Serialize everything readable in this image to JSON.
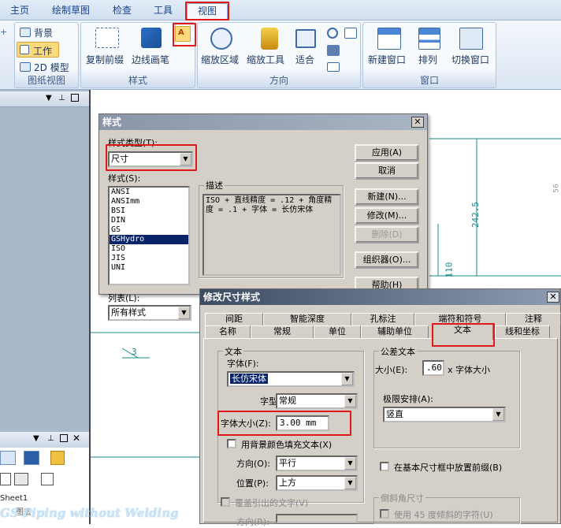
{
  "tabs": [
    "主页",
    "绘制草图",
    "检查",
    "工具",
    "视图"
  ],
  "ribbon": {
    "sheet_view_group": {
      "label": "图纸视图",
      "items": [
        "背景",
        "工作",
        "2D 模型"
      ]
    },
    "style_group": {
      "label": "样式",
      "items": [
        "复制前缀",
        "边线画笔"
      ]
    },
    "orient_group": {
      "label": "方向",
      "items": [
        "缩放区域",
        "缩放工具",
        "适合"
      ]
    },
    "window_group": {
      "label": "窗口",
      "items": [
        "新建窗口",
        "排列",
        "切换窗口"
      ]
    }
  },
  "left_panel": {
    "sheet": "Sheet1",
    "bottom_label": "图层"
  },
  "canvas": {
    "dim_1": "242.5",
    "dim_2": "110",
    "leader": "3",
    "side_dim": "56"
  },
  "dlg_style": {
    "title": "样式",
    "style_type_label": "样式类型(T):",
    "style_type_value": "尺寸",
    "styles_label": "样式(S):",
    "styles": [
      "ANSI",
      "ANSImm",
      "BSI",
      "DIN",
      "GS",
      "GSHydro",
      "ISO",
      "JIS",
      "UNI"
    ],
    "selected_style": "GSHydro",
    "list_label": "列表(L):",
    "list_value": "所有样式",
    "desc_label": "描述",
    "desc_text": "ISO + 直线精度 = .12 + 角度精度 = .1 + 字体 = 长仿宋体",
    "buttons": [
      "应用(A)",
      "取消",
      "新建(N)...",
      "修改(M)...",
      "删除(D)",
      "组织器(O)...",
      "帮助(H)"
    ]
  },
  "dlg_dim": {
    "title": "修改尺寸样式",
    "tabs_row1": [
      "间距",
      "智能深度",
      "孔标注",
      "端符和符号",
      "注释"
    ],
    "tabs_row2": [
      "名称",
      "常规",
      "单位",
      "辅助单位",
      "文本",
      "线和坐标"
    ],
    "active_tab": "文本",
    "text_group": "文本",
    "font_label": "字体(F):",
    "font_value": "长仿宋体",
    "style_label": "字型(S):",
    "style_value": "常规",
    "size_label": "字体大小(Z):",
    "size_value": "3.00 mm",
    "fill_bg_label": "用背景颜色填充文本(X)",
    "direction_label": "方向(O):",
    "direction_value": "平行",
    "position_label": "位置(P):",
    "position_value": "上方",
    "override_label": "覆盖引出的文字(V)",
    "direction2_label": "方向(R):",
    "tol_group": "公差文本",
    "tol_size_label": "大小(E):",
    "tol_size_value": ".60",
    "tol_size_suffix": "x 字体大小",
    "limit_label": "极限安排(A):",
    "limit_value": "竖直",
    "prefix_label": "在基本尺寸框中放置前缀(B)",
    "chamfer_group": "倒斜角尺寸",
    "chamfer_label": "使用 45 度倾斜的字符(U)"
  },
  "watermark": "GS Piping without Welding",
  "colors": {
    "highlight": "#e0181a",
    "selection": "#0a246a",
    "canvas_line": "#1a8a8a"
  }
}
